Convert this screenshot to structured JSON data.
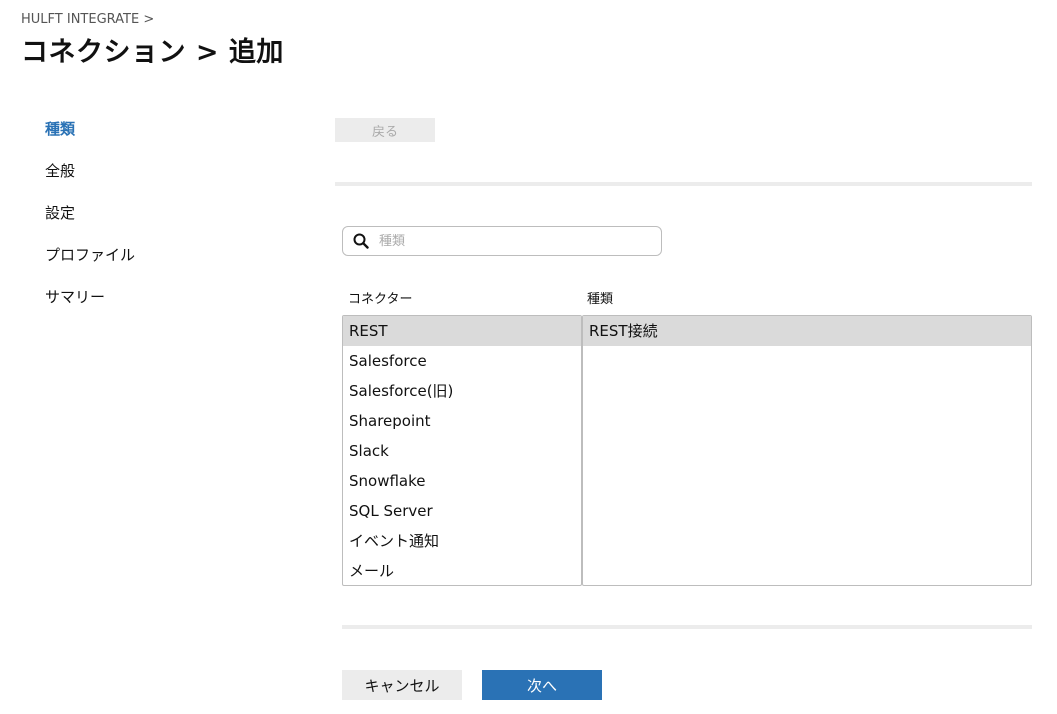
{
  "header": {
    "breadcrumb": "HULFT INTEGRATE >",
    "title": "コネクション > 追加"
  },
  "steps": [
    {
      "label": "種類",
      "active": true
    },
    {
      "label": "全般",
      "active": false
    },
    {
      "label": "設定",
      "active": false
    },
    {
      "label": "プロファイル",
      "active": false
    },
    {
      "label": "サマリー",
      "active": false
    }
  ],
  "toolbar": {
    "back_label": "戻る"
  },
  "search": {
    "placeholder": "種類",
    "value": "",
    "icon": "search-icon"
  },
  "columns": {
    "connector_header": "コネクター",
    "type_header": "種類"
  },
  "connectors": [
    {
      "label": "REST",
      "selected": true
    },
    {
      "label": "Salesforce",
      "selected": false
    },
    {
      "label": "Salesforce(旧)",
      "selected": false
    },
    {
      "label": "Sharepoint",
      "selected": false
    },
    {
      "label": "Slack",
      "selected": false
    },
    {
      "label": "Snowflake",
      "selected": false
    },
    {
      "label": "SQL Server",
      "selected": false
    },
    {
      "label": "イベント通知",
      "selected": false
    },
    {
      "label": "メール",
      "selected": false
    }
  ],
  "types": [
    {
      "label": "REST接続",
      "selected": true
    }
  ],
  "footer": {
    "cancel_label": "キャンセル",
    "next_label": "次へ"
  },
  "colors": {
    "accent": "#2a72b5",
    "selected_row": "#dadada",
    "muted_button": "#ececec"
  }
}
